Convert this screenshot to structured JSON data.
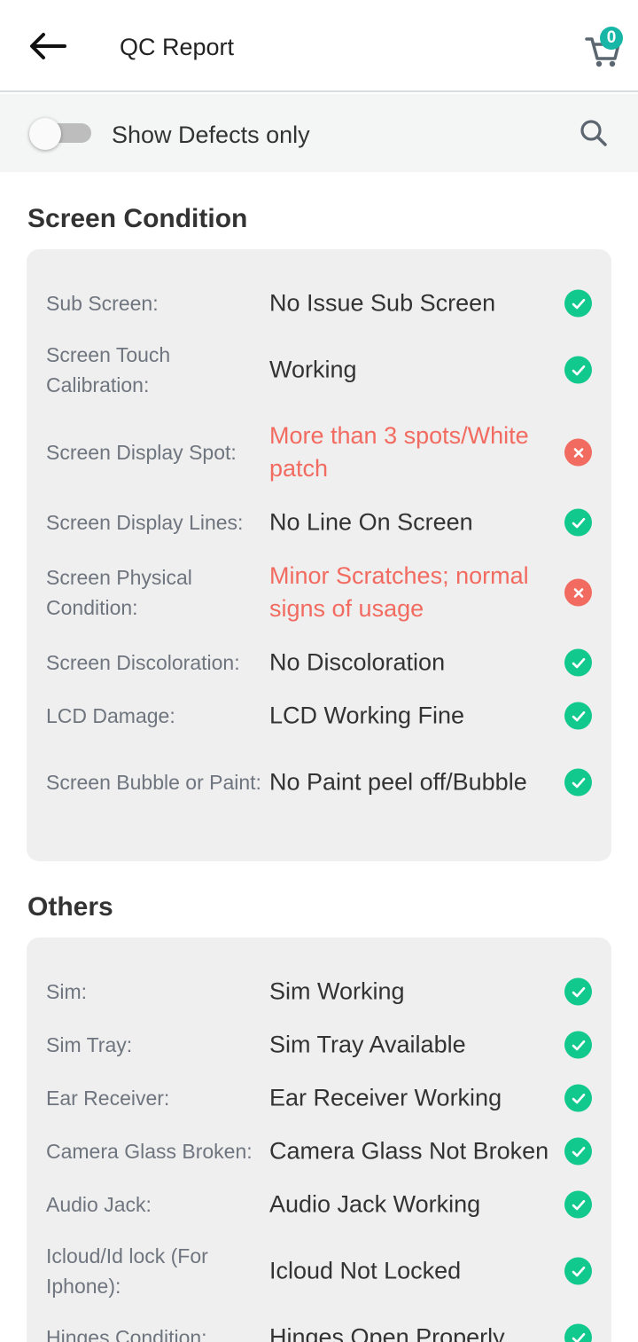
{
  "header": {
    "title": "QC Report",
    "cart_count": "0",
    "accent_color": "#18b6a6"
  },
  "filter": {
    "toggle_label": "Show Defects only",
    "toggle_on": false
  },
  "icons": {
    "back": "arrow-left-icon",
    "cart": "shopping-cart-icon",
    "search": "search-icon",
    "ok": "check-circle-icon",
    "defect": "x-circle-icon"
  },
  "colors": {
    "ok": "#12c98d",
    "defect": "#f26b60"
  },
  "sections": [
    {
      "title": "Screen Condition",
      "items": [
        {
          "label": "Sub Screen:",
          "value": "No Issue Sub Screen",
          "status": "ok"
        },
        {
          "label": "Screen Touch Calibration:",
          "value": "Working",
          "status": "ok"
        },
        {
          "label": "Screen Display Spot:",
          "value": "More than 3 spots/White patch",
          "status": "defect"
        },
        {
          "label": "Screen Display Lines:",
          "value": "No Line On Screen",
          "status": "ok"
        },
        {
          "label": "Screen Physical Condition:",
          "value": "Minor Scratches; normal signs of usage",
          "status": "defect"
        },
        {
          "label": "Screen Discoloration:",
          "value": "No Discoloration",
          "status": "ok"
        },
        {
          "label": "LCD Damage:",
          "value": "LCD Working Fine",
          "status": "ok"
        },
        {
          "label": "Screen Bubble or Paint:",
          "value": "No Paint peel off/Bubble",
          "status": "ok"
        }
      ]
    },
    {
      "title": "Others",
      "items": [
        {
          "label": "Sim:",
          "value": "Sim Working",
          "status": "ok"
        },
        {
          "label": "Sim Tray:",
          "value": "Sim Tray Available",
          "status": "ok"
        },
        {
          "label": "Ear Receiver:",
          "value": "Ear Receiver Working",
          "status": "ok"
        },
        {
          "label": "Camera Glass Broken:",
          "value": "Camera Glass Not Broken",
          "status": "ok"
        },
        {
          "label": "Audio Jack:",
          "value": "Audio Jack Working",
          "status": "ok"
        },
        {
          "label": "Icloud/Id lock (For Iphone):",
          "value": "Icloud Not Locked",
          "status": "ok"
        },
        {
          "label": "Hinges Condition:",
          "value": "Hinges Open Properly",
          "status": "ok"
        }
      ]
    }
  ]
}
